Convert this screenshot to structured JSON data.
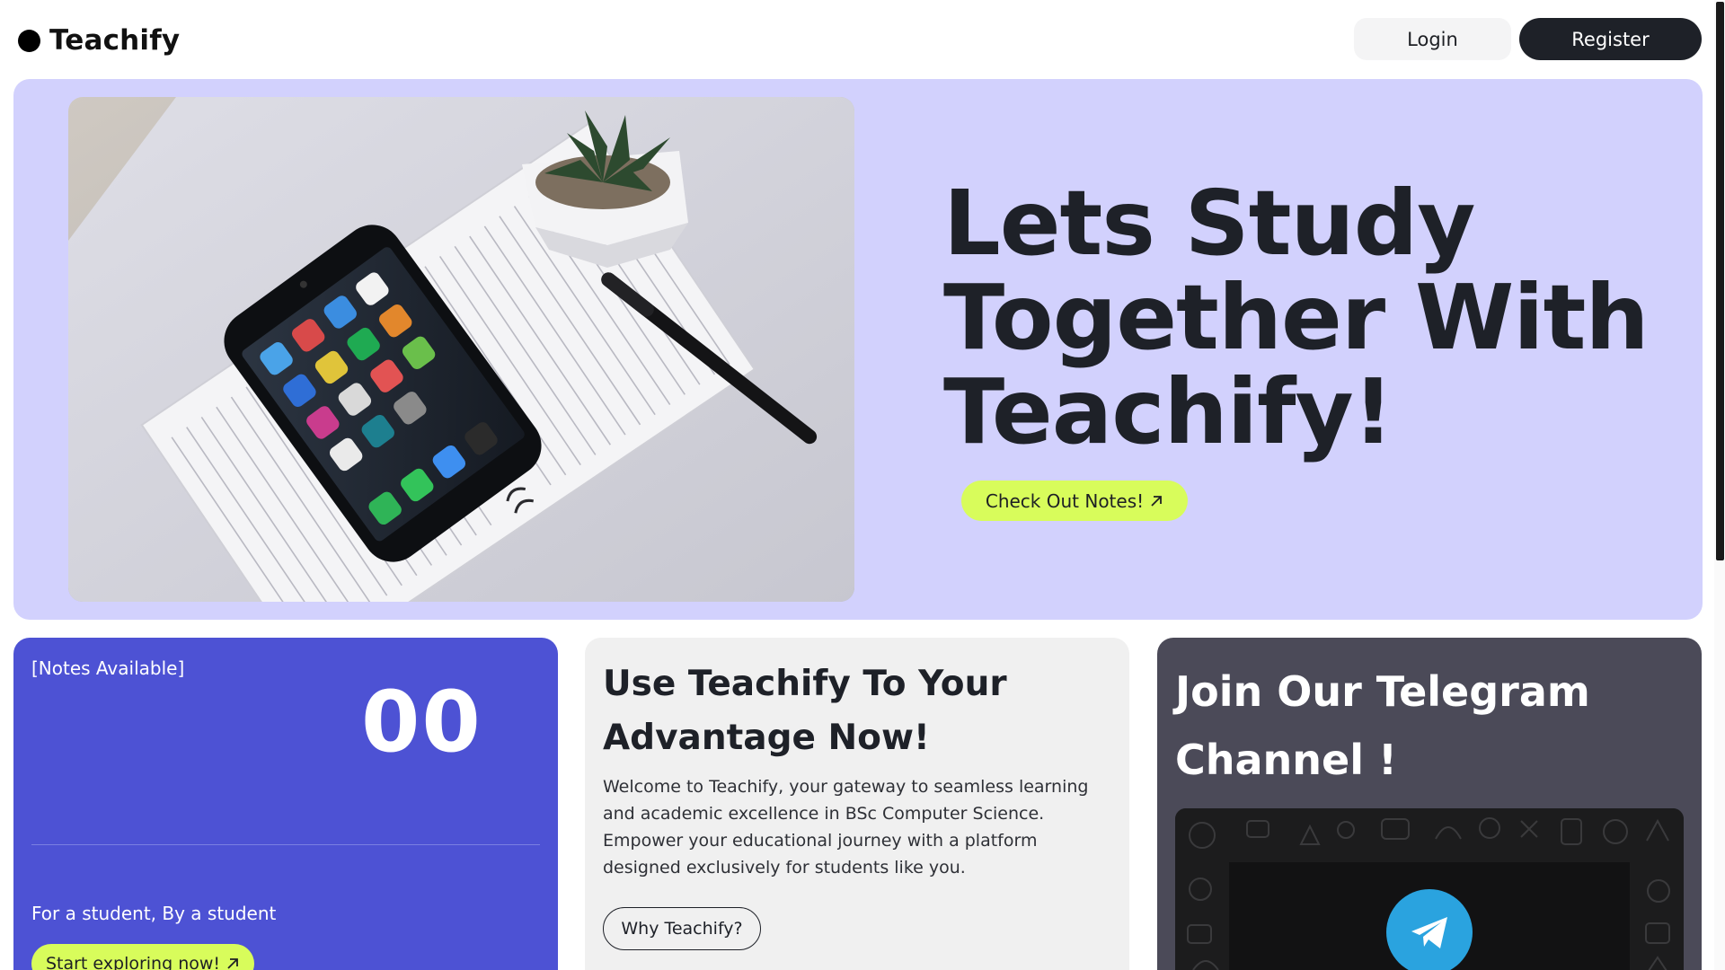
{
  "header": {
    "brand": "Teachify",
    "login_label": "Login",
    "register_label": "Register"
  },
  "hero": {
    "title": "Lets Study Together With Teachify!",
    "cta_label": "Check Out Notes!",
    "cta_icon": "arrow-up-right-icon",
    "image": "phone-notebook-plant-photo",
    "background": "#d2d1fd"
  },
  "notes_card": {
    "label": "[Notes Available]",
    "count": "00",
    "tagline": "For a student, By a student",
    "cta_label": "Start exploring now!",
    "cta_icon": "arrow-up-right-icon",
    "background": "#4d52d4"
  },
  "advantage_card": {
    "title": "Use Teachify To Your Advantage Now!",
    "body": "Welcome to Teachify, your gateway to seamless learning and academic excellence in BSc Computer Science. Empower your educational journey with a platform designed exclusively for students like you.",
    "button_label": "Why Teachify?"
  },
  "telegram_card": {
    "title": "Join Our Telegram Channel !",
    "icon": "telegram-icon",
    "background": "#4b4a58"
  },
  "colors": {
    "accent_lime": "#d8fc5b",
    "dark": "#1e2128",
    "telegram_blue": "#2aa3df"
  }
}
